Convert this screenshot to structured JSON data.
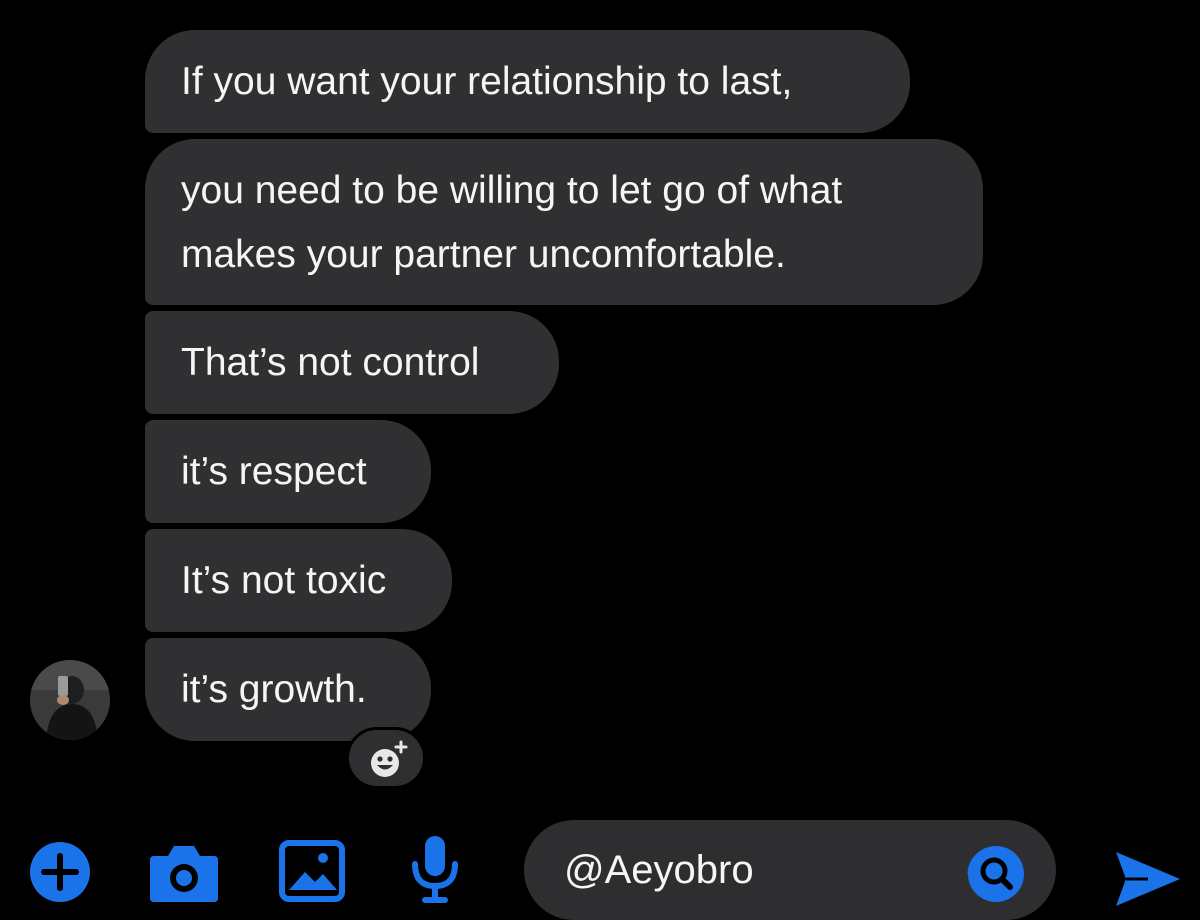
{
  "messages": [
    {
      "text": "If you want your relationship to last,"
    },
    {
      "line1": "you need to be willing to let go of what",
      "line2": "makes your partner uncomfortable."
    },
    {
      "text": "That’s not control"
    },
    {
      "text": "it’s respect"
    },
    {
      "text": "It’s not toxic"
    },
    {
      "text": "it’s growth."
    }
  ],
  "composer": {
    "input_value": "@Aeyobro",
    "icons": [
      "plus-icon",
      "camera-icon",
      "gallery-icon",
      "microphone-icon",
      "search-icon",
      "send-icon"
    ]
  },
  "colors": {
    "background": "#000000",
    "bubble": "#303033",
    "accent": "#1a73e8",
    "text": "#f5f5f5"
  }
}
